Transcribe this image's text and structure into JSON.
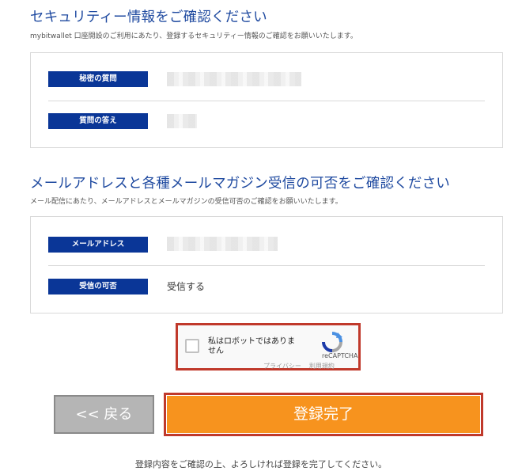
{
  "security": {
    "title": "セキュリティー情報をご確認ください",
    "subtitle": "mybitwallet 口座開設のご利用にあたり、登録するセキュリティー情報のご確認をお願いいたします。",
    "rows": [
      {
        "label": "秘密の質問",
        "value": ""
      },
      {
        "label": "質問の答え",
        "value": ""
      }
    ]
  },
  "email": {
    "title": "メールアドレスと各種メールマガジン受信の可否をご確認ください",
    "subtitle": "メール配信にあたり、メールアドレスとメールマガジンの受信可否のご確認をお願いいたします。",
    "rows": [
      {
        "label": "メールアドレス",
        "value": ""
      },
      {
        "label": "受信の可否",
        "value": "受信する"
      }
    ]
  },
  "captcha": {
    "label": "私はロボットではありません",
    "brand": "reCAPTCHA",
    "privacy_link": "プライバシー",
    "terms_link": "利用規約"
  },
  "buttons": {
    "back_label": "<< 戻る",
    "submit_label": "登録完了"
  },
  "footer": {
    "note": "登録内容をご確認の上、よろしければ登録を完了してください。"
  },
  "colors": {
    "accent_blue": "#1f4aa0",
    "label_navy": "#0a3697",
    "submit_orange": "#f7931e",
    "back_gray": "#b5b5b5",
    "highlight_red": "#c0392b"
  }
}
